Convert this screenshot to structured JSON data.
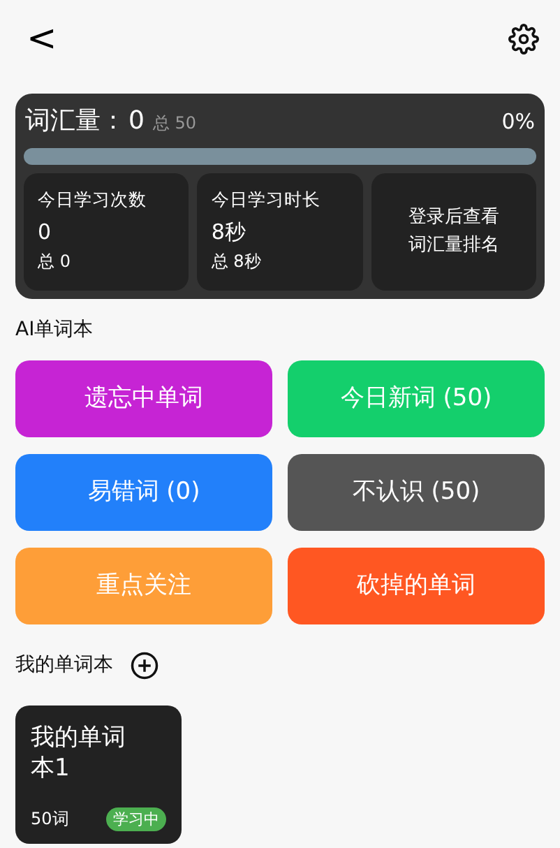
{
  "header": {
    "back": "<"
  },
  "vocab": {
    "label": "词汇量：",
    "count": "0",
    "total": "总 50",
    "percent": "0%",
    "level": 0,
    "stats": [
      {
        "kind": "stat",
        "title": "今日学习次数",
        "value": "0",
        "total": "总 0"
      },
      {
        "kind": "stat",
        "title": "今日学习时长",
        "value": "8秒",
        "total": "总 8秒"
      },
      {
        "kind": "login",
        "title": "登录后查看词汇量排名"
      }
    ]
  },
  "ai_section": {
    "title": "AI单词本",
    "books": [
      {
        "label": "遗忘中单词",
        "color": "#c624d4"
      },
      {
        "label": "今日新词 (50)",
        "color": "#14cf6c"
      },
      {
        "label": "易错词 (0)",
        "color": "#2280fa"
      },
      {
        "label": "不认识 (50)",
        "color": "#555555"
      },
      {
        "label": "重点关注",
        "color": "#fe9e38"
      },
      {
        "label": "砍掉的单词",
        "color": "#ff5722"
      }
    ]
  },
  "my_section": {
    "title": "我的单词本",
    "books": [
      {
        "name": "我的单词本1",
        "count": "50词",
        "badge": "学习中"
      }
    ]
  }
}
